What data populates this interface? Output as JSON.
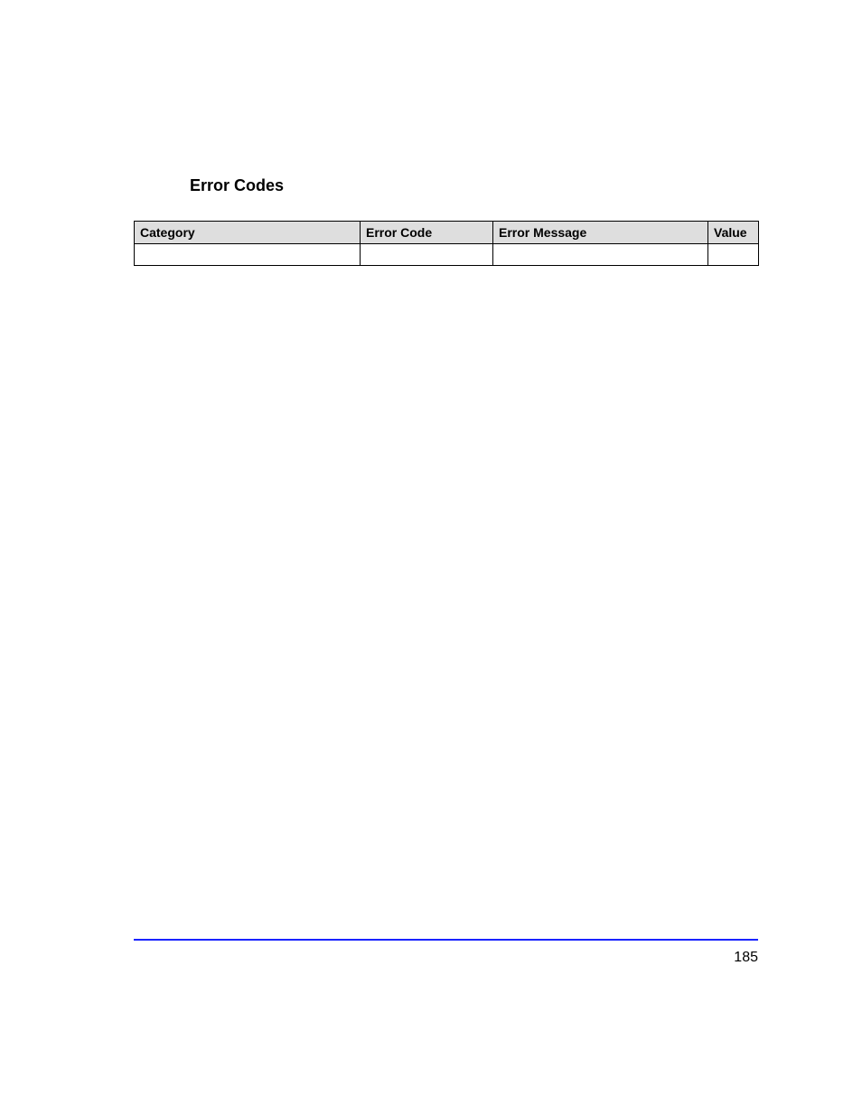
{
  "title": "Error Codes",
  "table": {
    "headers": {
      "category": "Category",
      "error_code": "Error Code",
      "error_message": "Error Message",
      "value": "Value"
    },
    "rows": [
      {
        "category": "",
        "error_code": "",
        "error_message": "",
        "value": ""
      }
    ]
  },
  "page_number": "185"
}
